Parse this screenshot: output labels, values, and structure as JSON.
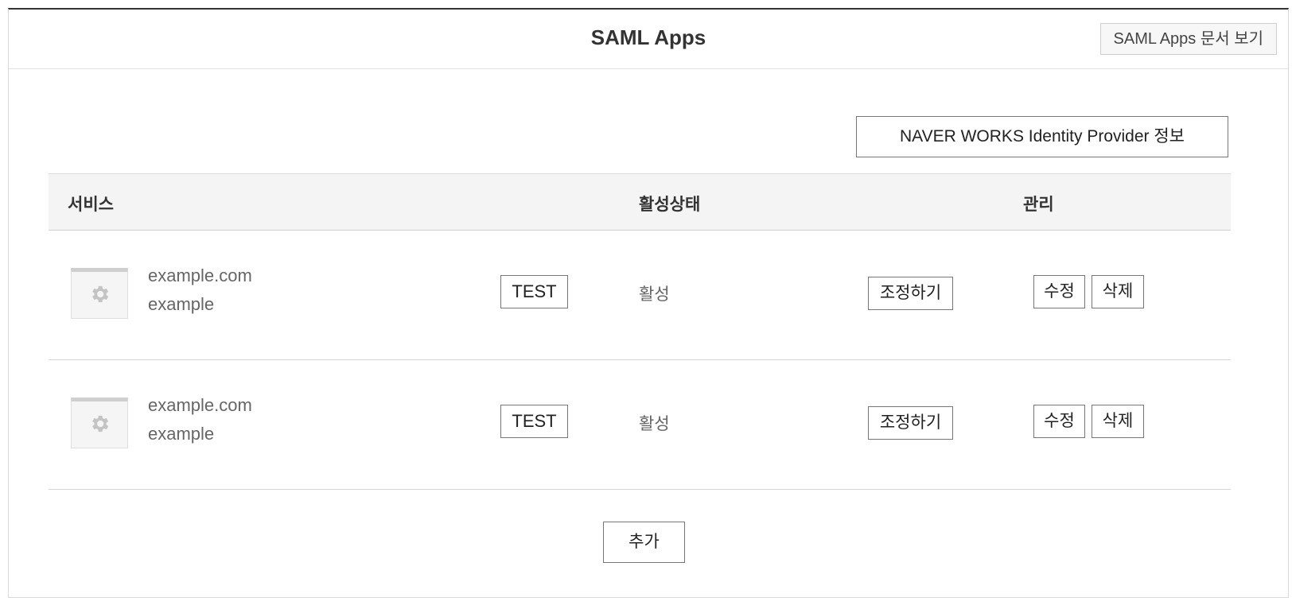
{
  "header": {
    "title": "SAML Apps",
    "doc_button_label": "SAML Apps 문서 보기"
  },
  "idp_button_label": "NAVER WORKS Identity Provider 정보",
  "table": {
    "columns": {
      "service": "서비스",
      "status": "활성상태",
      "manage": "관리"
    },
    "rows": [
      {
        "icon": "gear-icon",
        "domain": "example.com",
        "name": "example",
        "test_label": "TEST",
        "status": "활성",
        "adjust_label": "조정하기",
        "edit_label": "수정",
        "delete_label": "삭제"
      },
      {
        "icon": "gear-icon",
        "domain": "example.com",
        "name": "example",
        "test_label": "TEST",
        "status": "활성",
        "adjust_label": "조정하기",
        "edit_label": "수정",
        "delete_label": "삭제"
      }
    ]
  },
  "add_button_label": "추가"
}
